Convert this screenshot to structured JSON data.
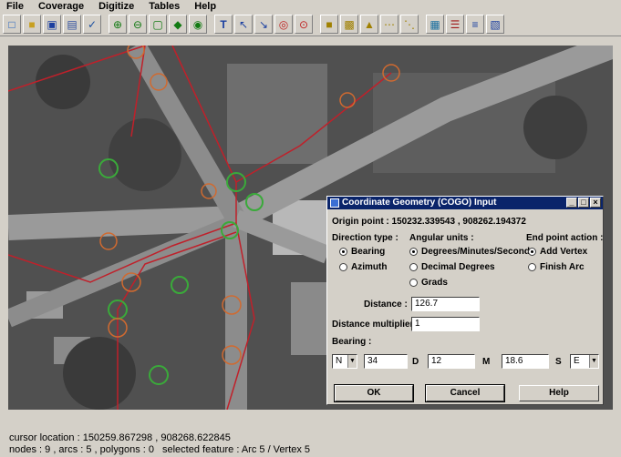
{
  "menu": [
    "File",
    "Coverage",
    "Digitize",
    "Tables",
    "Help"
  ],
  "toolbar_icons": [
    "new-icon",
    "open-icon",
    "save-icon",
    "print-icon",
    "check-icon",
    "zoom-in-icon",
    "zoom-out-icon",
    "zoom-extent-icon",
    "pan-icon",
    "globe-icon",
    "text-tool-icon",
    "select-tool-icon",
    "line-tool-icon",
    "circle-tool-icon",
    "circle-cross-icon",
    "lock-icon",
    "stack-icon",
    "digitize-icon",
    "vertex-chain-icon",
    "snap-icon",
    "map-icon",
    "table-icon",
    "list-icon",
    "calculator-icon"
  ],
  "status": {
    "cursor_location": "cursor location : 150259.867298 , 908268.622845",
    "counts": "nodes : 9 ,  arcs : 5 ,  polygons : 0",
    "selected_feature": "selected feature : Arc 5 / Vertex 5"
  },
  "dialog": {
    "title": "Coordinate Geometry (COGO) Input",
    "origin_point": "Origin point : 150232.339543 , 908262.194372",
    "direction_type_label": "Direction type :",
    "direction_options": [
      "Bearing",
      "Azimuth"
    ],
    "angular_units_label": "Angular units :",
    "angular_options": [
      "Degrees/Minutes/Seconds",
      "Decimal Degrees",
      "Grads"
    ],
    "end_point_label": "End point action :",
    "end_point_options": [
      "Add Vertex",
      "Finish Arc"
    ],
    "distance_label": "Distance :",
    "distance_value": "126.7",
    "multiplier_label": "Distance multiplier :",
    "multiplier_value": "1",
    "bearing_label": "Bearing :",
    "bearing_ns": "N",
    "degrees": "34",
    "d_label": "D",
    "minutes": "12",
    "m_label": "M",
    "seconds": "18.6",
    "s_label": "S",
    "bearing_ew": "E",
    "ok": "OK",
    "cancel": "Cancel",
    "help": "Help"
  }
}
